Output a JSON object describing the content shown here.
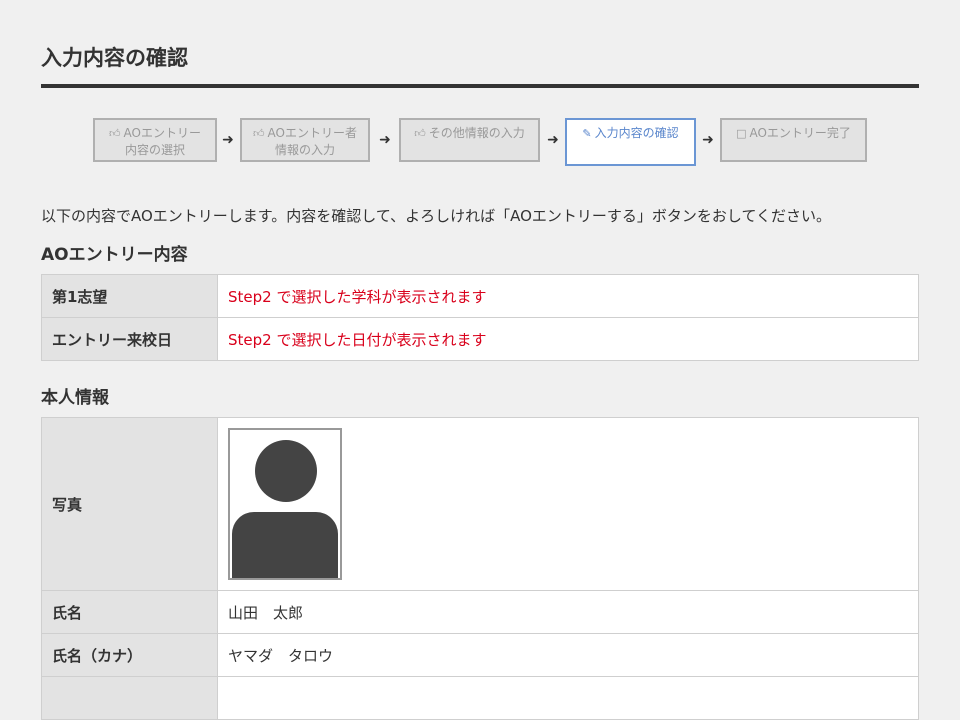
{
  "page": {
    "title": "入力内容の確認",
    "intro": "以下の内容でAOエントリーします。内容を確認して、よろしければ「AOエントリーする」ボタンをおしてください。"
  },
  "steps": [
    {
      "icon": "thumbs-up-icon",
      "line1": "AOエントリー",
      "line2": "内容の選択",
      "state": "done"
    },
    {
      "icon": "thumbs-up-icon",
      "line1": "AOエントリー者",
      "line2": "情報の入力",
      "state": "done"
    },
    {
      "icon": "thumbs-up-icon",
      "line1": "その他情報の入力",
      "line2": "",
      "state": "done"
    },
    {
      "icon": "edit-icon",
      "line1": "入力内容の確認",
      "line2": "",
      "state": "current"
    },
    {
      "icon": "square-icon",
      "line1": "AOエントリー完了",
      "line2": "",
      "state": "pending"
    }
  ],
  "entry_section": {
    "heading": "AOエントリー内容",
    "rows": [
      {
        "label": "第1志望",
        "value": "Step2 で選択した学科が表示されます"
      },
      {
        "label": "エントリー来校日",
        "value": "Step2 で選択した日付が表示されます"
      }
    ]
  },
  "personal_section": {
    "heading": "本人情報",
    "rows": [
      {
        "label": "写真",
        "value": ""
      },
      {
        "label": "氏名",
        "value": "山田　太郎"
      },
      {
        "label": "氏名（カナ）",
        "value": "ヤマダ　タロウ"
      }
    ]
  },
  "colors": {
    "accent": "#6b96d4",
    "note": "#d9001b",
    "heading_rule": "#333333"
  }
}
